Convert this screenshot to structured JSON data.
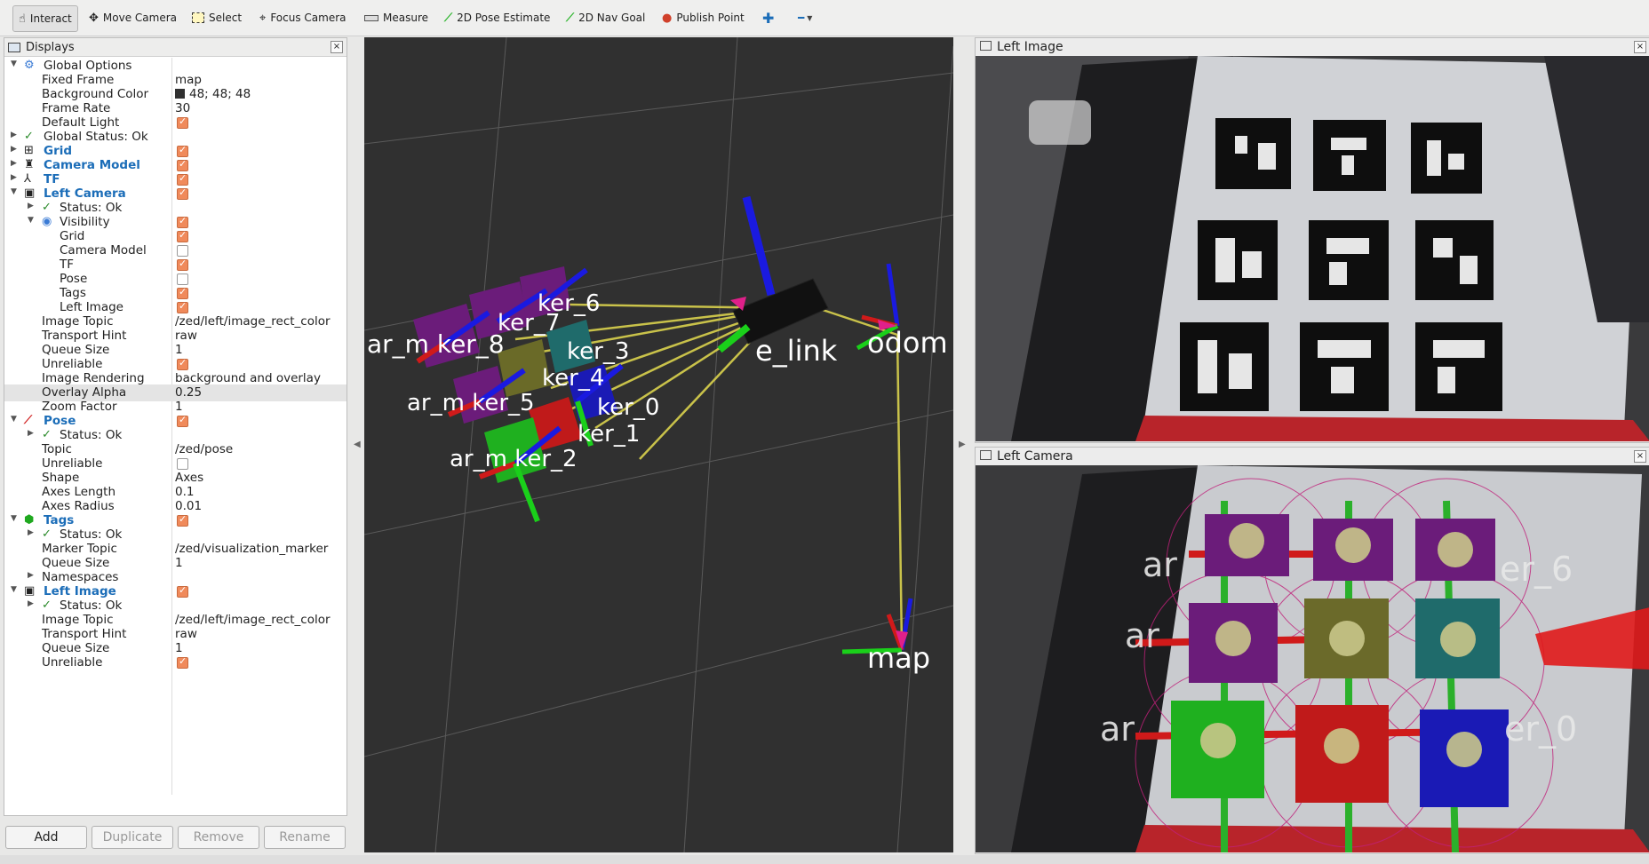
{
  "toolbar": {
    "interact": "Interact",
    "move_camera": "Move Camera",
    "select": "Select",
    "focus_camera": "Focus Camera",
    "measure": "Measure",
    "pose_estimate": "2D Pose Estimate",
    "nav_goal": "2D Nav Goal",
    "publish_point": "Publish Point"
  },
  "displays": {
    "title": "Displays",
    "rows": [
      {
        "name": "Global Options"
      },
      {
        "name": "Fixed Frame",
        "value": "map"
      },
      {
        "name": "Background Color",
        "value": "48; 48; 48"
      },
      {
        "name": "Frame Rate",
        "value": "30"
      },
      {
        "name": "Default Light"
      },
      {
        "name": "Global Status: Ok"
      },
      {
        "name": "Grid"
      },
      {
        "name": "Camera Model"
      },
      {
        "name": "TF"
      },
      {
        "name": "Left Camera"
      },
      {
        "name": "Status: Ok"
      },
      {
        "name": "Visibility"
      },
      {
        "name": "Grid"
      },
      {
        "name": "Camera Model"
      },
      {
        "name": "TF"
      },
      {
        "name": "Pose"
      },
      {
        "name": "Tags"
      },
      {
        "name": "Left Image"
      },
      {
        "name": "Image Topic",
        "value": "/zed/left/image_rect_color"
      },
      {
        "name": "Transport Hint",
        "value": "raw"
      },
      {
        "name": "Queue Size",
        "value": "1"
      },
      {
        "name": "Unreliable"
      },
      {
        "name": "Image Rendering",
        "value": "background and overlay"
      },
      {
        "name": "Overlay Alpha",
        "value": "0.25"
      },
      {
        "name": "Zoom Factor",
        "value": "1"
      },
      {
        "name": "Pose"
      },
      {
        "name": "Status: Ok"
      },
      {
        "name": "Topic",
        "value": "/zed/pose"
      },
      {
        "name": "Unreliable"
      },
      {
        "name": "Shape",
        "value": "Axes"
      },
      {
        "name": "Axes Length",
        "value": "0.1"
      },
      {
        "name": "Axes Radius",
        "value": "0.01"
      },
      {
        "name": "Tags"
      },
      {
        "name": "Status: Ok"
      },
      {
        "name": "Marker Topic",
        "value": "/zed/visualization_marker"
      },
      {
        "name": "Queue Size",
        "value": "1"
      },
      {
        "name": "Namespaces"
      },
      {
        "name": "Left Image"
      },
      {
        "name": "Status: Ok"
      },
      {
        "name": "Image Topic",
        "value": "/zed/left/image_rect_color"
      },
      {
        "name": "Transport Hint",
        "value": "raw"
      },
      {
        "name": "Queue Size",
        "value": "1"
      },
      {
        "name": "Unreliable"
      }
    ]
  },
  "buttons": {
    "add": "Add",
    "duplicate": "Duplicate",
    "remove": "Remove",
    "rename": "Rename"
  },
  "scene": {
    "labels": {
      "odom": "odom",
      "map": "map",
      "base_link": "e_link",
      "m8": "ar_m  ker_8",
      "m6": "ker_6",
      "m7": "ker_7",
      "m3": "ker_3",
      "m4": "ker_4",
      "m5": "ar_m  ker_5",
      "m0": "ker_0",
      "m1": "ker_1",
      "m2": "ar_m  ker_2"
    }
  },
  "left_image": {
    "title": "Left Image"
  },
  "left_camera": {
    "title": "Left Camera",
    "overlay": {
      "a1": "ar",
      "a2": "ar",
      "a3": "ar",
      "r6": "er_6",
      "r0": "er_0"
    }
  }
}
